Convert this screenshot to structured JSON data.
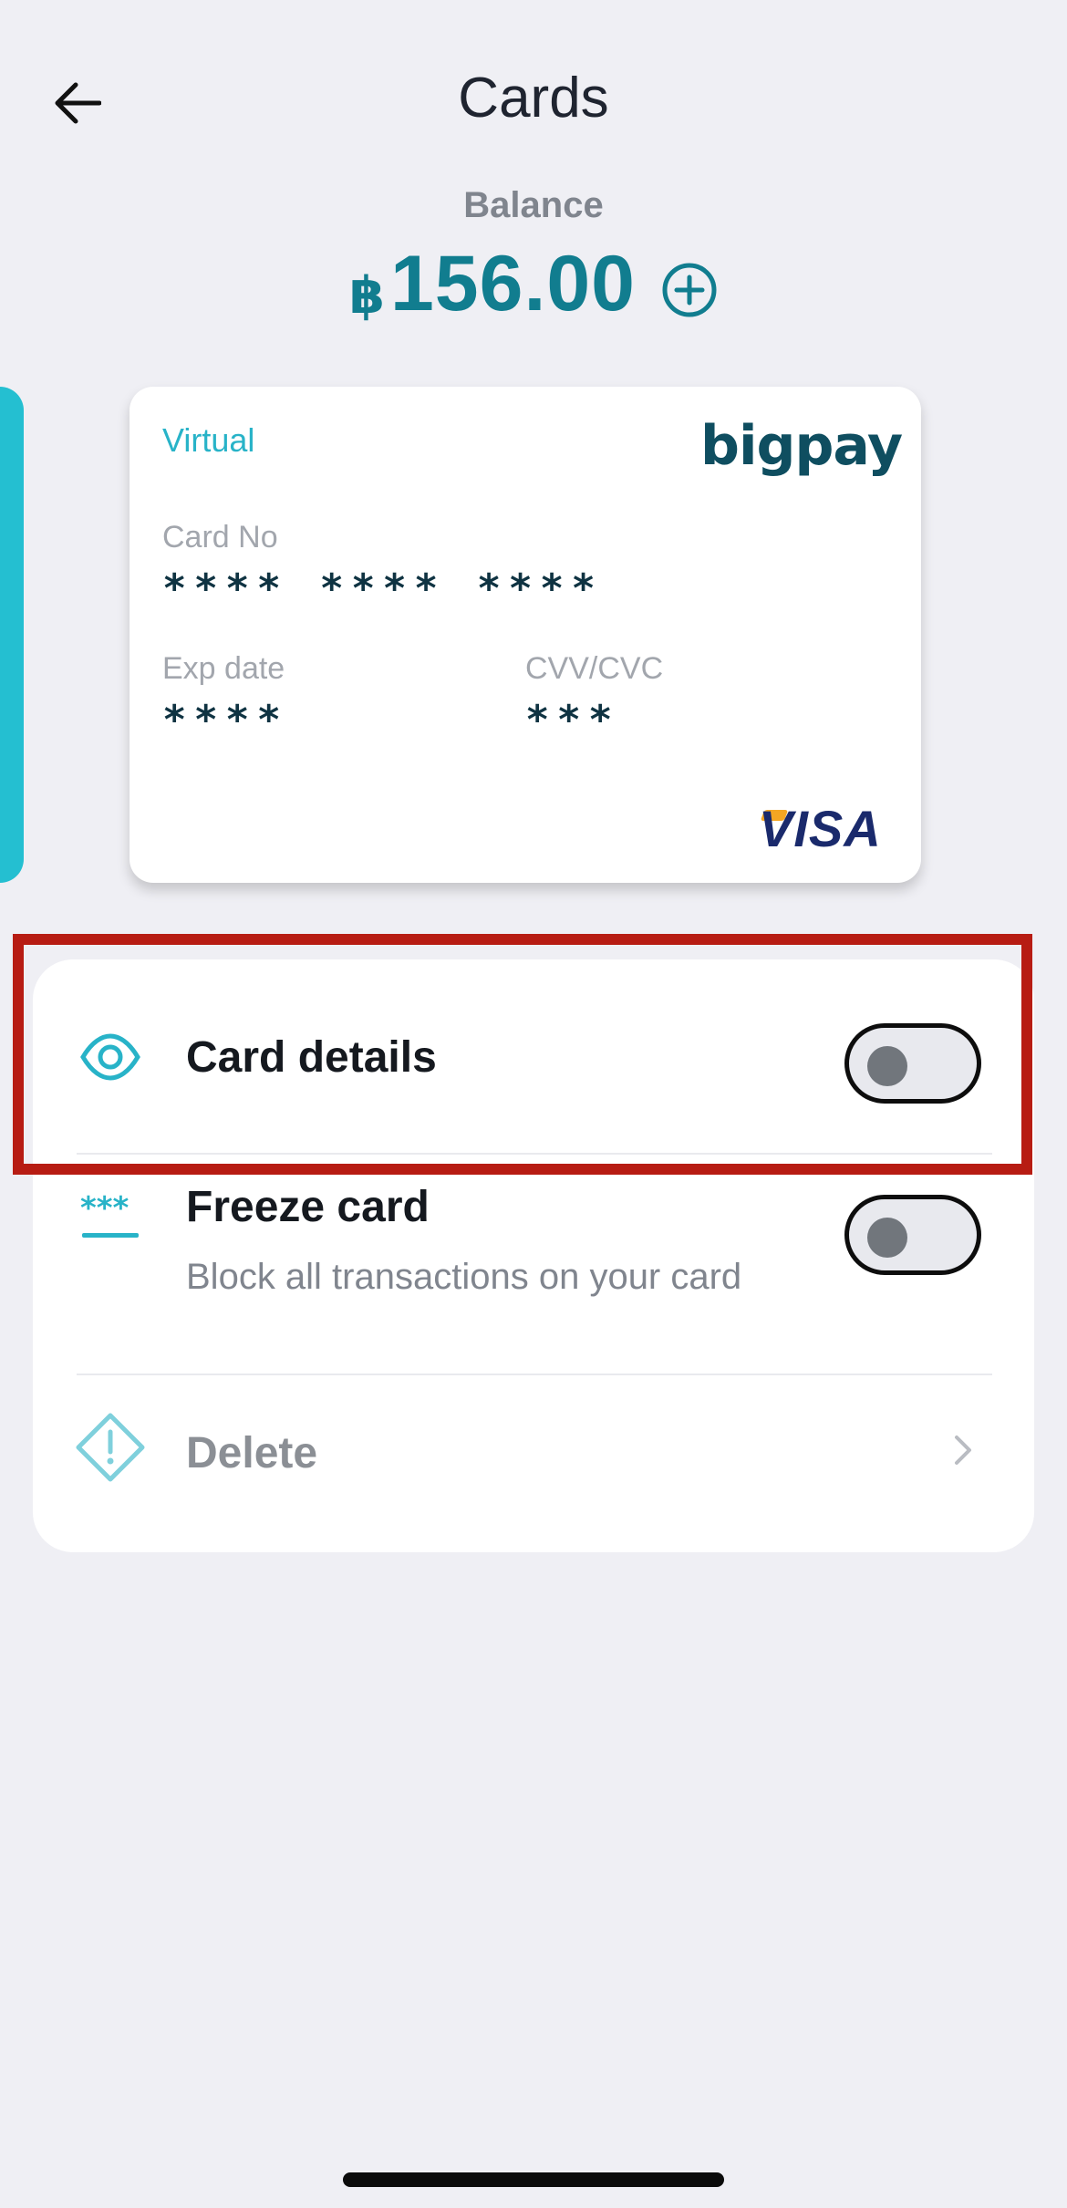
{
  "header": {
    "title": "Cards",
    "back_icon": "arrow-left-icon"
  },
  "balance": {
    "label": "Balance",
    "currency": "฿",
    "amount": "156.00",
    "topup_icon": "plus-circle-icon"
  },
  "card": {
    "type": "Virtual",
    "brand": "bigpay",
    "card_no_label": "Card No",
    "card_no_value": "**** **** ****",
    "exp_label": "Exp date",
    "exp_value": "****",
    "cvv_label": "CVV/CVC",
    "cvv_value": "***",
    "network": "VISA"
  },
  "settings": [
    {
      "label": "Card details",
      "icon": "eye-icon",
      "toggle_on": false
    },
    {
      "label": "Freeze card",
      "sub": "Block all transactions on your card",
      "icon": "asterisks-icon",
      "toggle_on": false
    },
    {
      "label": "Delete",
      "icon": "warning-diamond-icon",
      "chevron_icon": "chevron-right-icon"
    }
  ],
  "colors": {
    "background": "#efeff4",
    "accent_teal": "#117d8f",
    "card_accent": "#24bfd1",
    "highlight": "#b71c13"
  }
}
